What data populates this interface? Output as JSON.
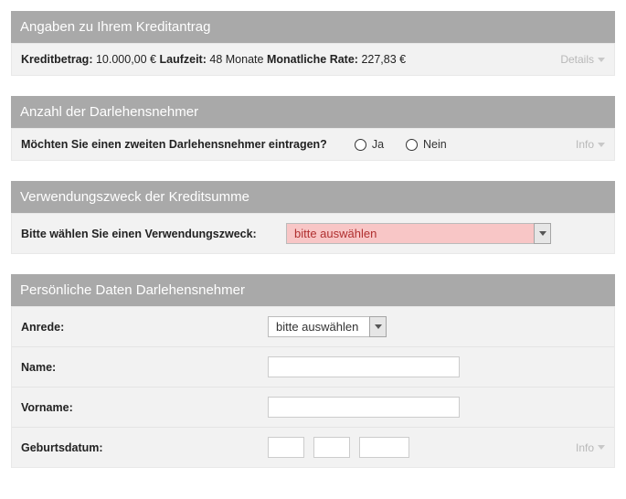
{
  "sections": {
    "summary": {
      "title": "Angaben zu Ihrem Kreditantrag",
      "labels": {
        "amount": "Kreditbetrag:",
        "term": "Laufzeit:",
        "rate": "Monatliche Rate:"
      },
      "values": {
        "amount": "10.000,00 €",
        "term": "48 Monate",
        "rate": "227,83 €"
      },
      "details_link": "Details"
    },
    "borrowers": {
      "title": "Anzahl der Darlehensnehmer",
      "question": "Möchten Sie einen zweiten Darlehensnehmer eintragen?",
      "options": {
        "yes": "Ja",
        "no": "Nein"
      },
      "info_link": "Info"
    },
    "purpose": {
      "title": "Verwendungszweck der Kreditsumme",
      "label": "Bitte wählen Sie einen Verwendungszweck:",
      "selected": "bitte auswählen"
    },
    "personal": {
      "title": "Persönliche Daten Darlehensnehmer",
      "fields": {
        "salutation": {
          "label": "Anrede:",
          "selected": "bitte auswählen"
        },
        "lastname": {
          "label": "Name:",
          "value": ""
        },
        "firstname": {
          "label": "Vorname:",
          "value": ""
        },
        "dob": {
          "label": "Geburtsdatum:",
          "day": "",
          "month": "",
          "year": ""
        }
      },
      "info_link": "Info"
    }
  }
}
